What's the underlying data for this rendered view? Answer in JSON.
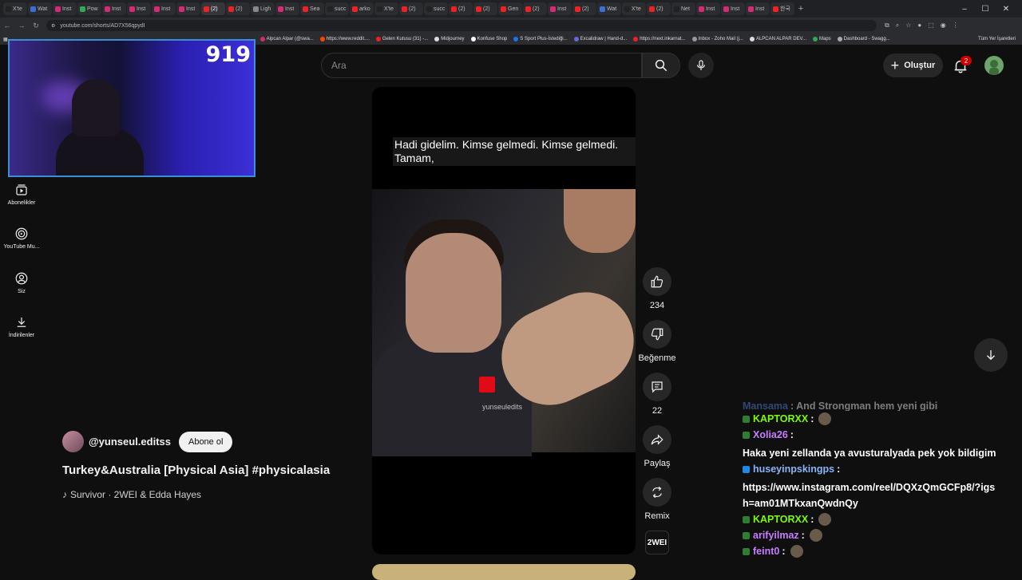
{
  "browser": {
    "tabs": [
      {
        "label": "X'te",
        "color": "#222"
      },
      {
        "label": "Wat",
        "color": "#3b6fd8"
      },
      {
        "label": "Inst",
        "color": "#d62976"
      },
      {
        "label": "Pow",
        "color": "#34a853"
      },
      {
        "label": "Inst",
        "color": "#d62976"
      },
      {
        "label": "Inst",
        "color": "#d62976"
      },
      {
        "label": "Inst",
        "color": "#d62976"
      },
      {
        "label": "Inst",
        "color": "#d62976"
      },
      {
        "label": "(2)",
        "color": "#e22"
      },
      {
        "label": "(2)",
        "color": "#e22"
      },
      {
        "label": "Ligh",
        "color": "#888"
      },
      {
        "label": "Inst",
        "color": "#d62976"
      },
      {
        "label": "Sea",
        "color": "#e22"
      },
      {
        "label": "succ",
        "color": "#222"
      },
      {
        "label": "arko",
        "color": "#e22"
      },
      {
        "label": "X'te",
        "color": "#222"
      },
      {
        "label": "(2)",
        "color": "#e22"
      },
      {
        "label": "succ",
        "color": "#222"
      },
      {
        "label": "(2)",
        "color": "#e22"
      },
      {
        "label": "(2)",
        "color": "#e22"
      },
      {
        "label": "Gen",
        "color": "#e22"
      },
      {
        "label": "(2)",
        "color": "#e22"
      },
      {
        "label": "Inst",
        "color": "#d62976"
      },
      {
        "label": "(2)",
        "color": "#e22"
      },
      {
        "label": "Wat",
        "color": "#3b6fd8"
      },
      {
        "label": "X'te",
        "color": "#222"
      },
      {
        "label": "(2)",
        "color": "#e22"
      },
      {
        "label": "Net",
        "color": "#222"
      },
      {
        "label": "Inst",
        "color": "#d62976"
      },
      {
        "label": "Inst",
        "color": "#d62976"
      },
      {
        "label": "Inst",
        "color": "#d62976"
      },
      {
        "label": "한국",
        "color": "#e22"
      }
    ],
    "new_tab": "+",
    "window_controls": {
      "minimize": "–",
      "maximize": "☐",
      "close": "✕"
    },
    "url": "youtube.com/shorts/AD7X56qpydI",
    "bookmarks": [
      {
        "label": "Alpcan Alpar (@swa...",
        "color": "#d62976"
      },
      {
        "label": "https://www.reddit....",
        "color": "#ff4500"
      },
      {
        "label": "Gelen Kutusu (31) -...",
        "color": "#e22"
      },
      {
        "label": "Midjourney",
        "color": "#ddd"
      },
      {
        "label": "Konfuse Shop",
        "color": "#fff"
      },
      {
        "label": "S Sport Plus-İstediği...",
        "color": "#1a73e8"
      },
      {
        "label": "Excalidraw | Hand-d...",
        "color": "#6965db"
      },
      {
        "label": "https://next.inkarnat...",
        "color": "#e22"
      },
      {
        "label": "Inbox - Zoho Mail (j...",
        "color": "#999"
      },
      {
        "label": "ALPCAN ALPAR DEV...",
        "color": "#ddd"
      },
      {
        "label": "Maps",
        "color": "#34a853"
      },
      {
        "label": "Dashboard - Swagg...",
        "color": "#aaa"
      }
    ],
    "bookmarks_all": "Tüm Yer İşaretleri"
  },
  "webcam": {
    "viewer_count": "919"
  },
  "sidebar": [
    {
      "label": "Abonelikler",
      "icon": "subscriptions-icon"
    },
    {
      "label": "YouTube Mu...",
      "icon": "youtube-music-icon"
    },
    {
      "label": "Siz",
      "icon": "account-icon"
    },
    {
      "label": "İndirilenler",
      "icon": "download-icon"
    }
  ],
  "header": {
    "search_placeholder": "Ara",
    "create_label": "Oluştur",
    "notification_count": "2"
  },
  "video": {
    "caption": "Hadi gidelim.  Kimse gelmedi.  Kimse gelmedi. Tamam,",
    "watermark": "yunseuledits"
  },
  "actions": {
    "like_count": "234",
    "dislike_label": "Beğenme",
    "comment_count": "22",
    "share_label": "Paylaş",
    "remix_label": "Remix",
    "music_tile": "2WEI"
  },
  "channel": {
    "name": "@yunseul.editss",
    "subscribe_label": "Abone ol",
    "title": "Turkey&Australia [Physical Asia] #physicalasia",
    "song": "Survivor · 2WEI & Edda Hayes"
  },
  "chat": [
    {
      "user": "Mansama",
      "message": "And Strongman hem yeni gibi",
      "user_color": "#5b8def",
      "cut": true
    },
    {
      "user": "KAPTORXX",
      "message": "",
      "user_color": "#7cfc00",
      "emote": true
    },
    {
      "user": "Xolia26",
      "message": "Haka yeni zellanda ya avusturalyada pek yok bildigim",
      "user_color": "#c77dff"
    },
    {
      "user": "huseyinpskingps",
      "message": "https://www.instagram.com/reel/DQXzQmGCFp8/?igsh=am01MTkxanQwdnQy",
      "user_color": "#8ab4f8"
    },
    {
      "user": "KAPTORXX",
      "message": "",
      "user_color": "#7cfc00",
      "emote": true
    },
    {
      "user": "arifyilmaz",
      "message": "",
      "user_color": "#c77dff",
      "emote": true
    },
    {
      "user": "feint0",
      "message": "",
      "user_color": "#c77dff",
      "emote": true
    }
  ]
}
